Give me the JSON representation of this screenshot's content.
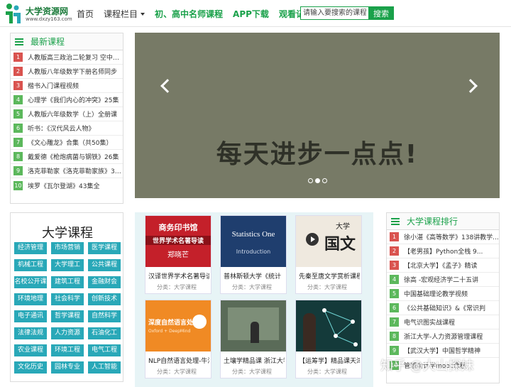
{
  "brand": {
    "title": "大学资源网",
    "url": "www.dxzy163.com"
  },
  "nav": {
    "items": [
      "首页",
      "课程栏目",
      "初、高中名师课程",
      "APP下载",
      "观看记录"
    ]
  },
  "search": {
    "placeholder": "请输入要搜索的课程！",
    "button": "搜索"
  },
  "latest": {
    "title": "最新课程",
    "items": [
      "人教版高三政治二轮复习 空中课...",
      "人教版八年级数学下册名师同步",
      "楷书入门课程视频",
      "心理学《我们内心的冲突》25集",
      "人教版六年级数学（上）全册课",
      "听书：《汉代风云人物》",
      "《文心雕龙》合集（共50集）",
      "戴爱德《枪炮病菌与钢铁》26集",
      "洛克菲勒家《洛克菲勒家族》38...",
      "埃罗《瓦尔登湖》43集全"
    ]
  },
  "carousel": {
    "text": "每天进步一点点!",
    "slide_count": 3,
    "active_index": 1
  },
  "university": {
    "title": "大学课程",
    "categories": [
      "经济管理",
      "市场营销",
      "医学课程",
      "机械工程",
      "大学理工",
      "公共课程",
      "名校公开课",
      "建筑工程",
      "金融财会",
      "环境地理",
      "社会科学",
      "创新技术",
      "电子通讯",
      "哲学课程",
      "自然科学",
      "法律法规",
      "人力资源",
      "石油化工",
      "农业课程",
      "环境工程",
      "电气工程",
      "文化历史",
      "园林专业",
      "人工智能"
    ]
  },
  "cards": [
    {
      "title": "汉译世界学术名著导读",
      "category": "分类：大学课程",
      "thumb_lines": [
        "商务印书馆",
        "世界学术名著导读",
        "郑晓芒"
      ]
    },
    {
      "title": "普林斯顿大学《统计",
      "category": "分类：大学课程",
      "thumb_lines": [
        "Statistics One",
        "Introduction"
      ]
    },
    {
      "title": "先秦至唐文学赏析课程",
      "category": "分类：大学课程",
      "thumb_lines": [
        "大学",
        "国文"
      ]
    },
    {
      "title": "NLP自然语言处理-牛津",
      "category": "分类：大学课程",
      "thumb_lines": [
        "深度自然语言处理",
        "Oxford + DeepMind"
      ]
    },
    {
      "title": "土壤学精品课 浙江大学",
      "category": "分类：大学课程",
      "thumb_lines": []
    },
    {
      "title": "【运筹学】精品课天津",
      "category": "分类：大学课程",
      "thumb_lines": []
    }
  ],
  "ranking": {
    "title": "大学课程排行",
    "items": [
      "徐小湛《高等数学》138讲教学...",
      "【老男孩】Python全栈 9...",
      "【北京大学】《孟子》精读",
      "徐高 -宏观经济学二十五讲",
      "中国基础理论教学视频",
      "《公共基础知识》&《常识判",
      "电气识图实战课程",
      "浙江大学-人力资源管理课程",
      "【武汉大学】中国哲学精神",
      "管理会计学mooc课程"
    ]
  },
  "watermark": "知乎 @大山探妹",
  "colors": {
    "brand_green": "#1aa14a",
    "category_teal": "#29a8b8",
    "carousel_bg": "#777a66",
    "rank_red": "#d9534f",
    "rank_green": "#5cb85c"
  }
}
